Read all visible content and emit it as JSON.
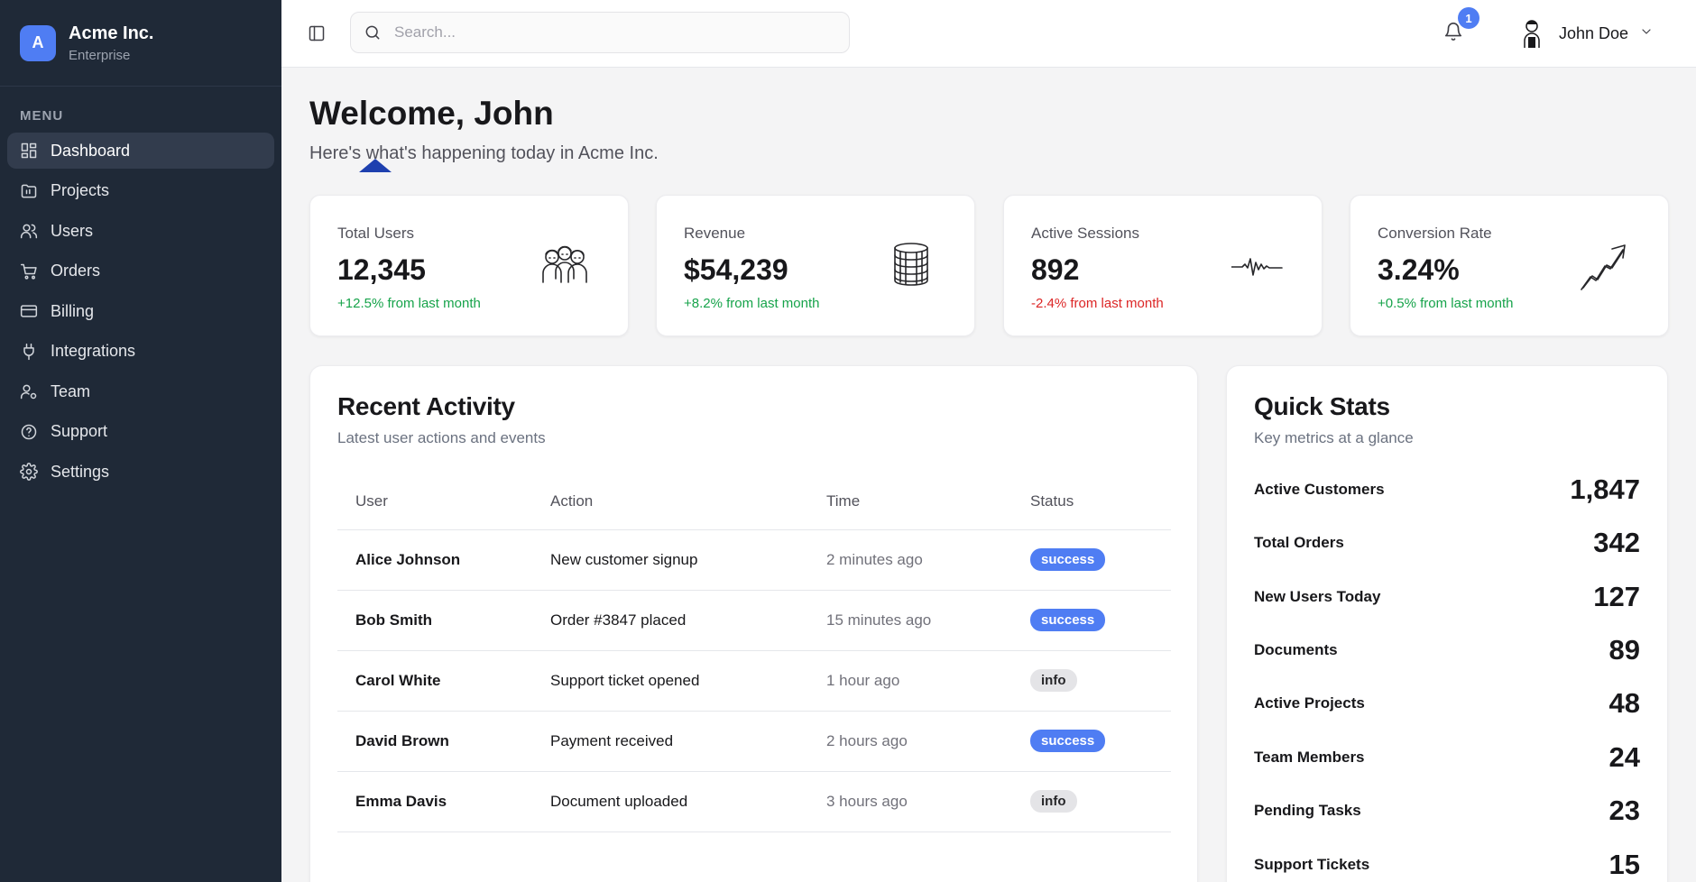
{
  "brand": {
    "logo_letter": "A",
    "name": "Acme Inc.",
    "plan": "Enterprise"
  },
  "sidebar": {
    "heading": "MENU",
    "items": [
      {
        "label": "Dashboard",
        "icon": "dashboard-icon",
        "active": true
      },
      {
        "label": "Projects",
        "icon": "folder-icon"
      },
      {
        "label": "Users",
        "icon": "users-icon"
      },
      {
        "label": "Orders",
        "icon": "cart-icon"
      },
      {
        "label": "Billing",
        "icon": "credit-card-icon"
      },
      {
        "label": "Integrations",
        "icon": "plug-icon"
      },
      {
        "label": "Team",
        "icon": "team-icon"
      },
      {
        "label": "Support",
        "icon": "help-circle-icon"
      },
      {
        "label": "Settings",
        "icon": "gear-icon"
      }
    ]
  },
  "topbar": {
    "search_placeholder": "Search...",
    "notification_count": "1",
    "user_name": "John Doe"
  },
  "page": {
    "title": "Welcome, John",
    "subtitle": "Here's what's happening today in Acme Inc."
  },
  "stats": [
    {
      "title": "Total Users",
      "value": "12,345",
      "change": "+12.5% from last month",
      "trend": "positive",
      "icon": "people-illustration-icon"
    },
    {
      "title": "Revenue",
      "value": "$54,239",
      "change": "+8.2% from last month",
      "trend": "positive",
      "icon": "coin-stack-icon"
    },
    {
      "title": "Active Sessions",
      "value": "892",
      "change": "-2.4% from last month",
      "trend": "negative",
      "icon": "pulse-wave-icon"
    },
    {
      "title": "Conversion Rate",
      "value": "3.24%",
      "change": "+0.5% from last month",
      "trend": "positive",
      "icon": "trend-arrow-icon"
    }
  ],
  "activity": {
    "title": "Recent Activity",
    "subtitle": "Latest user actions and events",
    "columns": [
      "User",
      "Action",
      "Time",
      "Status"
    ],
    "rows": [
      {
        "user": "Alice Johnson",
        "action": "New customer signup",
        "time": "2 minutes ago",
        "status": "success"
      },
      {
        "user": "Bob Smith",
        "action": "Order #3847 placed",
        "time": "15 minutes ago",
        "status": "success"
      },
      {
        "user": "Carol White",
        "action": "Support ticket opened",
        "time": "1 hour ago",
        "status": "info"
      },
      {
        "user": "David Brown",
        "action": "Payment received",
        "time": "2 hours ago",
        "status": "success"
      },
      {
        "user": "Emma Davis",
        "action": "Document uploaded",
        "time": "3 hours ago",
        "status": "info"
      }
    ]
  },
  "quick_stats": {
    "title": "Quick Stats",
    "subtitle": "Key metrics at a glance",
    "items": [
      {
        "label": "Active Customers",
        "value": "1,847"
      },
      {
        "label": "Total Orders",
        "value": "342"
      },
      {
        "label": "New Users Today",
        "value": "127"
      },
      {
        "label": "Documents",
        "value": "89"
      },
      {
        "label": "Active Projects",
        "value": "48"
      },
      {
        "label": "Team Members",
        "value": "24"
      },
      {
        "label": "Pending Tasks",
        "value": "23"
      },
      {
        "label": "Support Tickets",
        "value": "15"
      }
    ]
  },
  "colors": {
    "accent": "#4f7df3",
    "sidebar_bg": "#1f2937",
    "positive": "#16a34a",
    "negative": "#dc2626"
  }
}
